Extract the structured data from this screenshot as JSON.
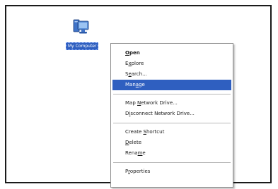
{
  "desktop": {
    "icon": {
      "name": "computer-icon",
      "label": "My Computer"
    }
  },
  "context_menu": {
    "groups": [
      {
        "items": [
          {
            "pre": "",
            "key": "O",
            "post": "pen",
            "bold": true,
            "highlighted": false
          },
          {
            "pre": "E",
            "key": "x",
            "post": "plore",
            "bold": false,
            "highlighted": false
          },
          {
            "pre": "S",
            "key": "e",
            "post": "arch...",
            "bold": false,
            "highlighted": false
          },
          {
            "pre": "Man",
            "key": "a",
            "post": "ge",
            "bold": false,
            "highlighted": true
          }
        ]
      },
      {
        "items": [
          {
            "pre": "Map ",
            "key": "N",
            "post": "etwork Drive...",
            "bold": false,
            "highlighted": false
          },
          {
            "pre": "D",
            "key": "i",
            "post": "sconnect Network Drive...",
            "bold": false,
            "highlighted": false
          }
        ]
      },
      {
        "items": [
          {
            "pre": "Create ",
            "key": "S",
            "post": "hortcut",
            "bold": false,
            "highlighted": false
          },
          {
            "pre": "",
            "key": "D",
            "post": "elete",
            "bold": false,
            "highlighted": false
          },
          {
            "pre": "Rena",
            "key": "m",
            "post": "e",
            "bold": false,
            "highlighted": false
          }
        ]
      },
      {
        "items": [
          {
            "pre": "P",
            "key": "r",
            "post": "operties",
            "bold": false,
            "highlighted": false
          }
        ]
      }
    ]
  },
  "colors": {
    "selection": "#2f5fc0",
    "menu_text": "#1a1a1a",
    "frame_border": "#1a1a1a"
  }
}
